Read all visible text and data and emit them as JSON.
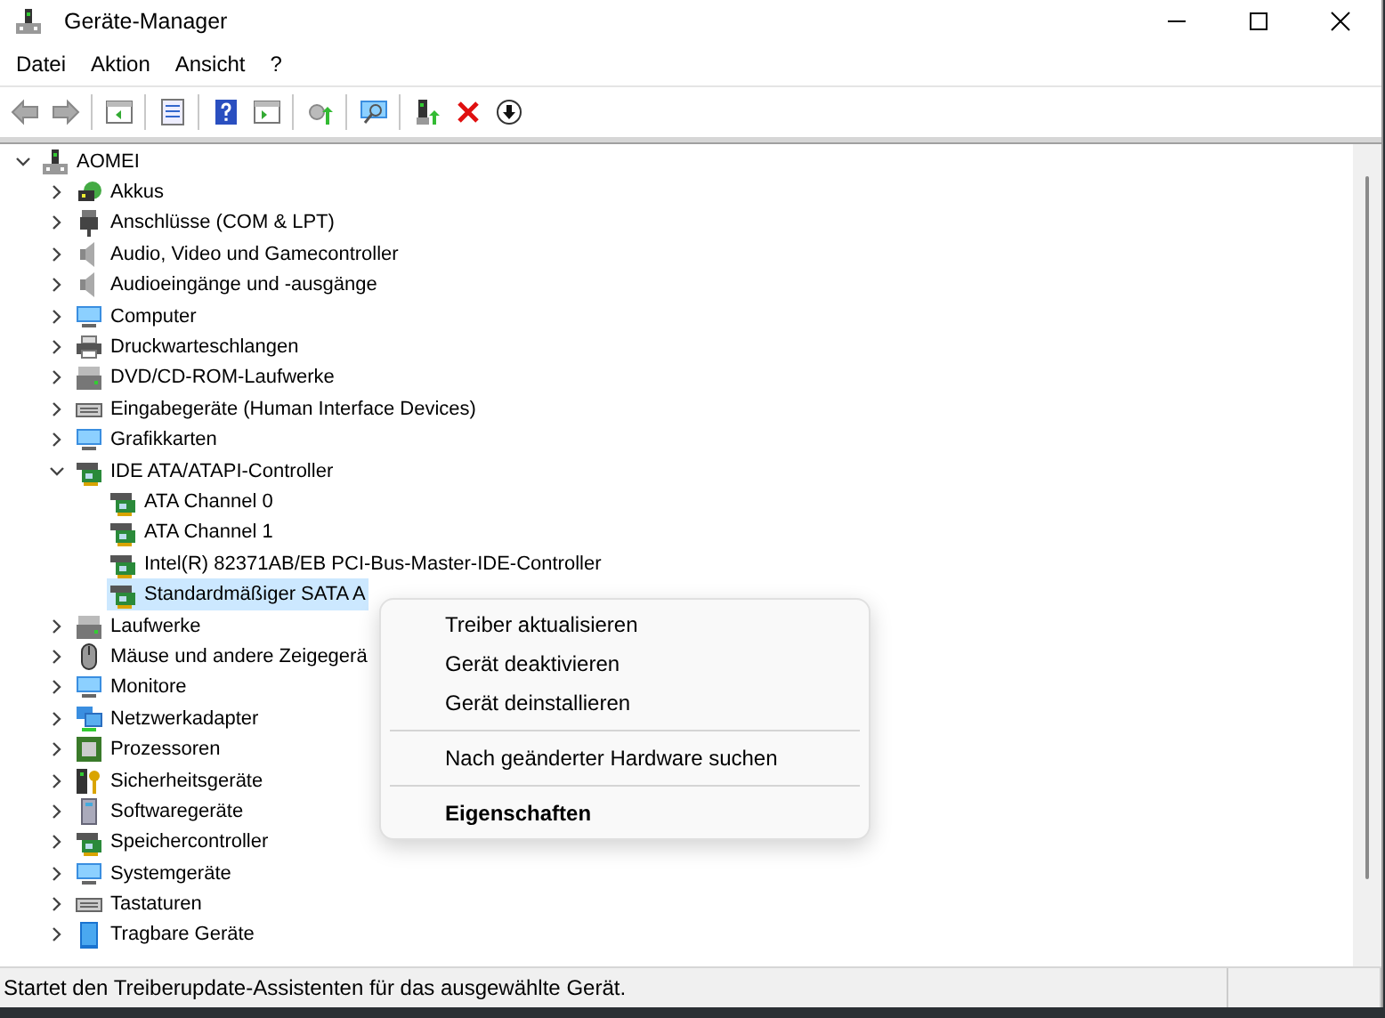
{
  "window": {
    "title": "Geräte-Manager"
  },
  "menu_bar": [
    "Datei",
    "Aktion",
    "Ansicht",
    "?"
  ],
  "tree": [
    {
      "label": "AOMEI",
      "expanded": true,
      "selected": false,
      "children": [
        {
          "label": "Akkus",
          "expanded": false,
          "selected": false
        },
        {
          "label": "Anschlüsse (COM & LPT)",
          "expanded": false,
          "selected": false
        },
        {
          "label": "Audio, Video und Gamecontroller",
          "expanded": false,
          "selected": false
        },
        {
          "label": "Audioeingänge und -ausgänge",
          "expanded": false,
          "selected": false
        },
        {
          "label": "Computer",
          "expanded": false,
          "selected": false
        },
        {
          "label": "Druckwarteschlangen",
          "expanded": false,
          "selected": false
        },
        {
          "label": "DVD/CD-ROM-Laufwerke",
          "expanded": false,
          "selected": false
        },
        {
          "label": "Eingabegeräte (Human Interface Devices)",
          "expanded": false,
          "selected": false
        },
        {
          "label": "Grafikkarten",
          "expanded": false,
          "selected": false
        },
        {
          "label": "IDE ATA/ATAPI-Controller",
          "expanded": true,
          "selected": false,
          "children": [
            {
              "label": "ATA Channel 0",
              "selected": false
            },
            {
              "label": "ATA Channel 1",
              "selected": false
            },
            {
              "label": "Intel(R) 82371AB/EB PCI-Bus-Master-IDE-Controller",
              "selected": false
            },
            {
              "label": "Standardmäßiger SATA A",
              "selected": true
            }
          ]
        },
        {
          "label": "Laufwerke",
          "expanded": false,
          "selected": false
        },
        {
          "label": "Mäuse und andere Zeigegerä",
          "expanded": false,
          "selected": false
        },
        {
          "label": "Monitore",
          "expanded": false,
          "selected": false
        },
        {
          "label": "Netzwerkadapter",
          "expanded": false,
          "selected": false
        },
        {
          "label": "Prozessoren",
          "expanded": false,
          "selected": false
        },
        {
          "label": "Sicherheitsgeräte",
          "expanded": false,
          "selected": false
        },
        {
          "label": "Softwaregeräte",
          "expanded": false,
          "selected": false
        },
        {
          "label": "Speichercontroller",
          "expanded": false,
          "selected": false
        },
        {
          "label": "Systemgeräte",
          "expanded": false,
          "selected": false
        },
        {
          "label": "Tastaturen",
          "expanded": false,
          "selected": false
        },
        {
          "label": "Tragbare Geräte",
          "expanded": false,
          "selected": false
        }
      ]
    }
  ],
  "context_menu": [
    {
      "label": "Treiber aktualisieren",
      "default": false,
      "separator_before": false
    },
    {
      "label": "Gerät deaktivieren",
      "default": false,
      "separator_before": false
    },
    {
      "label": "Gerät deinstallieren",
      "default": false,
      "separator_before": false
    },
    {
      "label": "Nach geänderter Hardware suchen",
      "default": false,
      "separator_before": true
    },
    {
      "label": "Eigenschaften",
      "default": true,
      "separator_before": true
    }
  ],
  "status_bar": "Startet den Treiberupdate-Assistenten für das ausgewählte Gerät."
}
